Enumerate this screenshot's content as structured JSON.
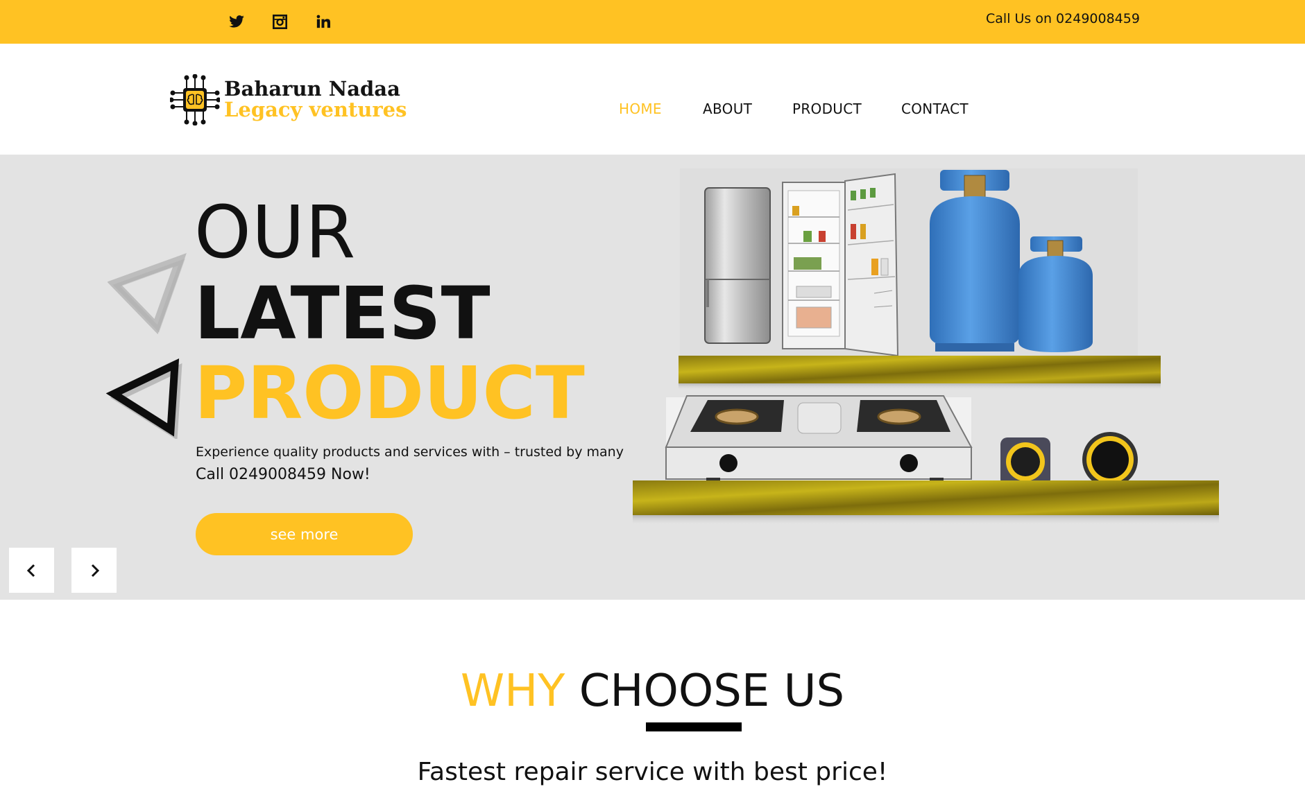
{
  "topbar": {
    "social": [
      {
        "name": "twitter-icon"
      },
      {
        "name": "instagram-icon"
      },
      {
        "name": "linkedin-icon"
      }
    ],
    "call_text": "Call Us on 0249008459",
    "color": "#ffc223"
  },
  "header": {
    "logo_line1": "Baharun Nadaa",
    "logo_line2": "Legacy ventures",
    "nav": [
      "HOME",
      "ABOUT",
      "PRODUCT",
      "CONTACT"
    ],
    "active_nav": "HOME"
  },
  "hero": {
    "line1": "OUR",
    "line2": "LATEST",
    "line3": "PRODUCT",
    "subtitle": "Experience quality products and services with – trusted by many",
    "call": "Call 0249008459 Now!",
    "button": "see more",
    "prev_icon": "chevron-left-icon",
    "next_icon": "chevron-right-icon"
  },
  "why": {
    "word1": "WHY",
    "word2": "CHOOSE US",
    "tagline": "Fastest repair service with best price!"
  },
  "colors": {
    "accent": "#ffc223",
    "hero_bg": "#e3e3e3",
    "text": "#111111"
  }
}
